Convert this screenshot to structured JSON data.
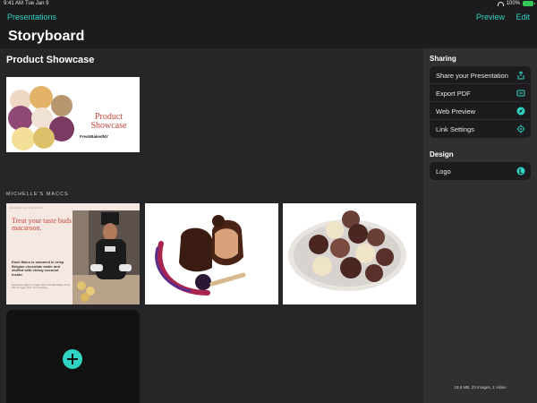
{
  "status": {
    "time": "9:41 AM",
    "date": "Tue Jan 9",
    "battery": "100%"
  },
  "nav": {
    "back_label": "Presentations",
    "preview_label": "Preview",
    "edit_label": "Edit",
    "title": "Storyboard"
  },
  "main": {
    "section_title": "Product Showcase",
    "cover": {
      "title": "Product Showcase",
      "subtitle": "FreshBakedNY"
    },
    "group_label": "MICHELLE'S MACCS",
    "slide": {
      "header": "MICHELLE'S MACCS",
      "headline": "Treat your taste buds to the ultimate macaroon.",
      "body": "Each Maco is smeared in crisp Belgian chocolate wafer and stuffed with chewy coconut inside.",
      "fine_print": "Experience Maco's in Apple, New York Manhattan. Fresh with our eggs. Fine. Try everything."
    }
  },
  "side": {
    "sharing_title": "Sharing",
    "sharing_items": [
      "Share your Presentation",
      "Export PDF",
      "Web Preview",
      "Link Settings"
    ],
    "design_title": "Design",
    "design_items": [
      "Logo"
    ],
    "footer": "18.6 MB, 23 Images, 1 Video"
  },
  "colors": {
    "accent": "#2fd3c1",
    "background": "#1c1c1e",
    "panel": "#303033",
    "brand_red": "#c8463b"
  }
}
